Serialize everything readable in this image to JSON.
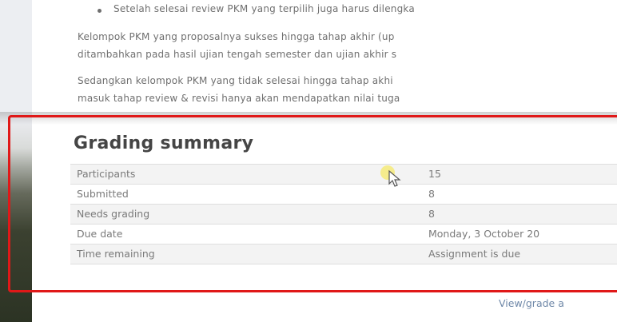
{
  "intro": {
    "bullet_text": "Setelah selesai review PKM yang terpilih juga harus dilengka",
    "para1_line1": "Kelompok PKM yang proposalnya sukses hingga tahap akhir (up",
    "para1_line2": "ditambahkan pada hasil ujian tengah semester dan ujian akhir s",
    "para2_line1": "Sedangkan kelompok PKM yang tidak selesai hingga tahap akhi",
    "para2_line2": "masuk tahap review & revisi hanya akan mendapatkan nilai tuga"
  },
  "grading": {
    "title": "Grading summary",
    "rows": [
      {
        "label": "Participants",
        "value": "15"
      },
      {
        "label": "Submitted",
        "value": "8"
      },
      {
        "label": "Needs grading",
        "value": "8"
      },
      {
        "label": "Due date",
        "value": "Monday, 3 October 20"
      },
      {
        "label": "Time remaining",
        "value": "Assignment is due"
      }
    ]
  },
  "footer": {
    "view_grade_link": "View/grade a"
  },
  "colors": {
    "highlight_border": "#e01818",
    "cursor_highlight": "#f5e96a"
  }
}
